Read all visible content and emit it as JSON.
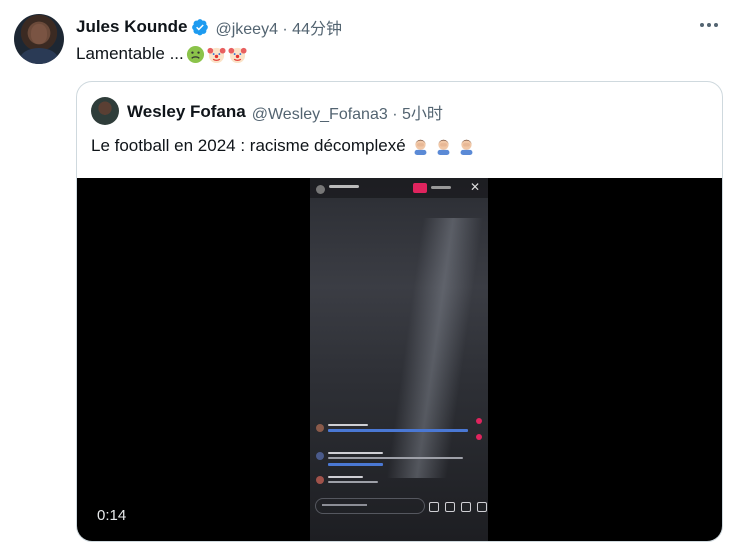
{
  "tweet": {
    "author_name": "Jules Kounde",
    "handle_time": "@jkeey4 · 44分钟",
    "text": "Lamentable ...",
    "emojis": [
      "nauseated-face",
      "clown-face",
      "clown-face"
    ]
  },
  "quote": {
    "author_name": "Wesley Fofana",
    "handle_time": "@Wesley_Fofana3 · 5小时",
    "text": "Le football en 2024 : racisme décomplexé",
    "emojis": [
      "man-facepalming",
      "man-facepalming",
      "man-facepalming"
    ],
    "video": {
      "timecode": "0:14"
    }
  },
  "colors": {
    "verified": "#1d9bf0",
    "muted_text": "#536471",
    "border": "#cfd9de",
    "live_badge": "#e0245e"
  }
}
